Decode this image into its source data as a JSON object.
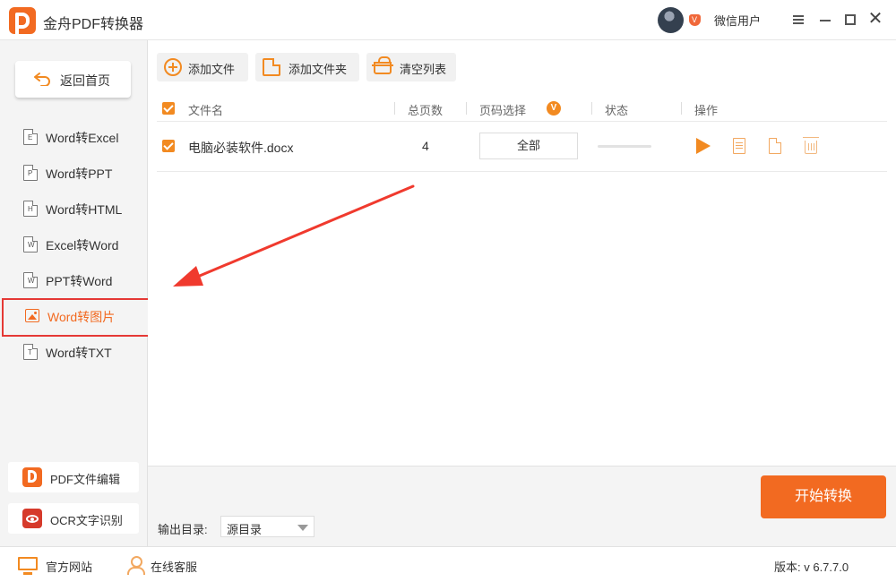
{
  "app": {
    "title": "金舟PDF转换器",
    "username": "微信用户",
    "vip_label": "V"
  },
  "sidebar": {
    "back_label": "返回首页",
    "items": [
      {
        "label": "Word转Excel",
        "icon_letter": "E"
      },
      {
        "label": "Word转PPT",
        "icon_letter": "P"
      },
      {
        "label": "Word转HTML",
        "icon_letter": "H"
      },
      {
        "label": "Excel转Word",
        "icon_letter": "W"
      },
      {
        "label": "PPT转Word",
        "icon_letter": "W"
      },
      {
        "label": "Word转图片",
        "icon_letter": ""
      },
      {
        "label": "Word转TXT",
        "icon_letter": "T"
      }
    ],
    "active_index": 5,
    "tools": [
      {
        "label": "PDF文件编辑"
      },
      {
        "label": "OCR文字识别"
      }
    ]
  },
  "toolbar": {
    "add_file": "添加文件",
    "add_folder": "添加文件夹",
    "clear_list": "清空列表"
  },
  "table": {
    "headers": {
      "filename": "文件名",
      "pages": "总页数",
      "page_select": "页码选择",
      "page_select_badge": "V",
      "status": "状态",
      "actions": "操作"
    },
    "rows": [
      {
        "filename": "电脑必装软件.docx",
        "pages": "4",
        "page_select": "全部",
        "checked": true
      }
    ]
  },
  "output": {
    "label": "输出目录:",
    "value": "源目录"
  },
  "start_button": "开始转换",
  "statusbar": {
    "website": "官方网站",
    "service": "在线客服",
    "version": "版本: v 6.7.7.0"
  },
  "colors": {
    "accent": "#f26a21",
    "highlight_border": "#e53935",
    "arrow": "#f03a2e"
  }
}
